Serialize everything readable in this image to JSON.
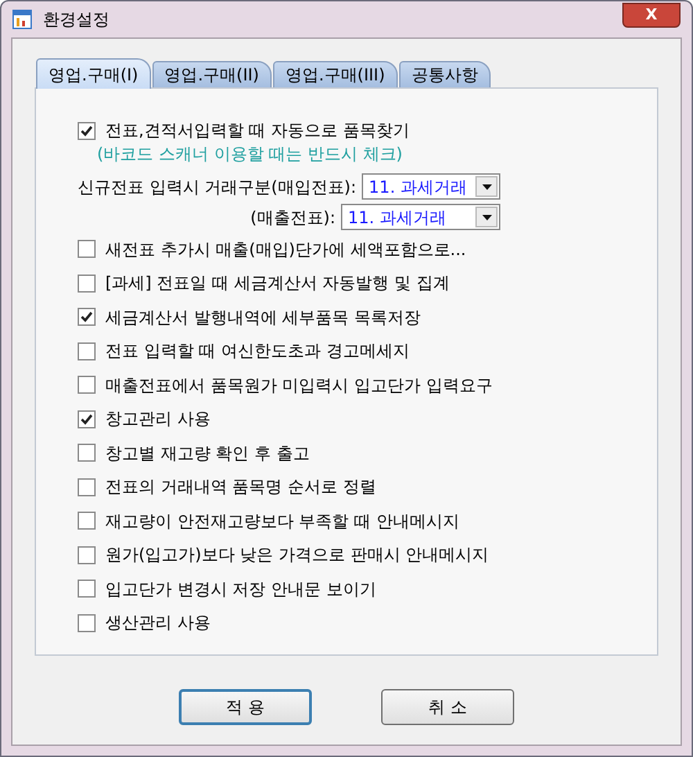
{
  "window": {
    "title": "환경설정",
    "close": "X"
  },
  "tabs": [
    {
      "label": "영업.구매(I)",
      "selected": true
    },
    {
      "label": "영업.구매(II)",
      "selected": false
    },
    {
      "label": "영업.구매(III)",
      "selected": false
    },
    {
      "label": "공통사항",
      "selected": false
    }
  ],
  "options": [
    {
      "kind": "checkbox",
      "label": "전표,견적서입력할 때 자동으로 품목찾기",
      "checked": true
    },
    {
      "kind": "note",
      "text": "(바코드 스캐너 이용할 때는 반드시 체크)"
    },
    {
      "kind": "select",
      "label": "신규전표 입력시 거래구분(매입전표):",
      "value": "11. 과세거래"
    },
    {
      "kind": "select",
      "label": "(매출전표):",
      "value": "11. 과세거래"
    },
    {
      "kind": "checkbox",
      "label": "새전표 추가시 매출(매입)단가에 세액포함으로...",
      "checked": false
    },
    {
      "kind": "checkbox",
      "label": "[과세] 전표일 때 세금계산서 자동발행 및 집계",
      "checked": false
    },
    {
      "kind": "checkbox",
      "label": "세금계산서 발행내역에 세부품목 목록저장",
      "checked": true
    },
    {
      "kind": "checkbox",
      "label": "전표 입력할 때 여신한도초과 경고메세지",
      "checked": false
    },
    {
      "kind": "checkbox",
      "label": "매출전표에서 품목원가 미입력시 입고단가 입력요구",
      "checked": false
    },
    {
      "kind": "checkbox",
      "label": "창고관리 사용",
      "checked": true
    },
    {
      "kind": "checkbox",
      "label": "창고별 재고량 확인 후 출고",
      "checked": false
    },
    {
      "kind": "checkbox",
      "label": "전표의 거래내역 품목명 순서로 정렬",
      "checked": false
    },
    {
      "kind": "checkbox",
      "label": "재고량이 안전재고량보다 부족할 때 안내메시지",
      "checked": false
    },
    {
      "kind": "checkbox",
      "label": "원가(입고가)보다 낮은 가격으로 판매시 안내메시지",
      "checked": false
    },
    {
      "kind": "checkbox",
      "label": "입고단가 변경시 저장 안내문 보이기",
      "checked": false
    },
    {
      "kind": "checkbox",
      "label": "생산관리 사용",
      "checked": false
    }
  ],
  "buttons": [
    {
      "label": "적 용",
      "selected": true
    },
    {
      "label": "취 소",
      "selected": false
    }
  ]
}
